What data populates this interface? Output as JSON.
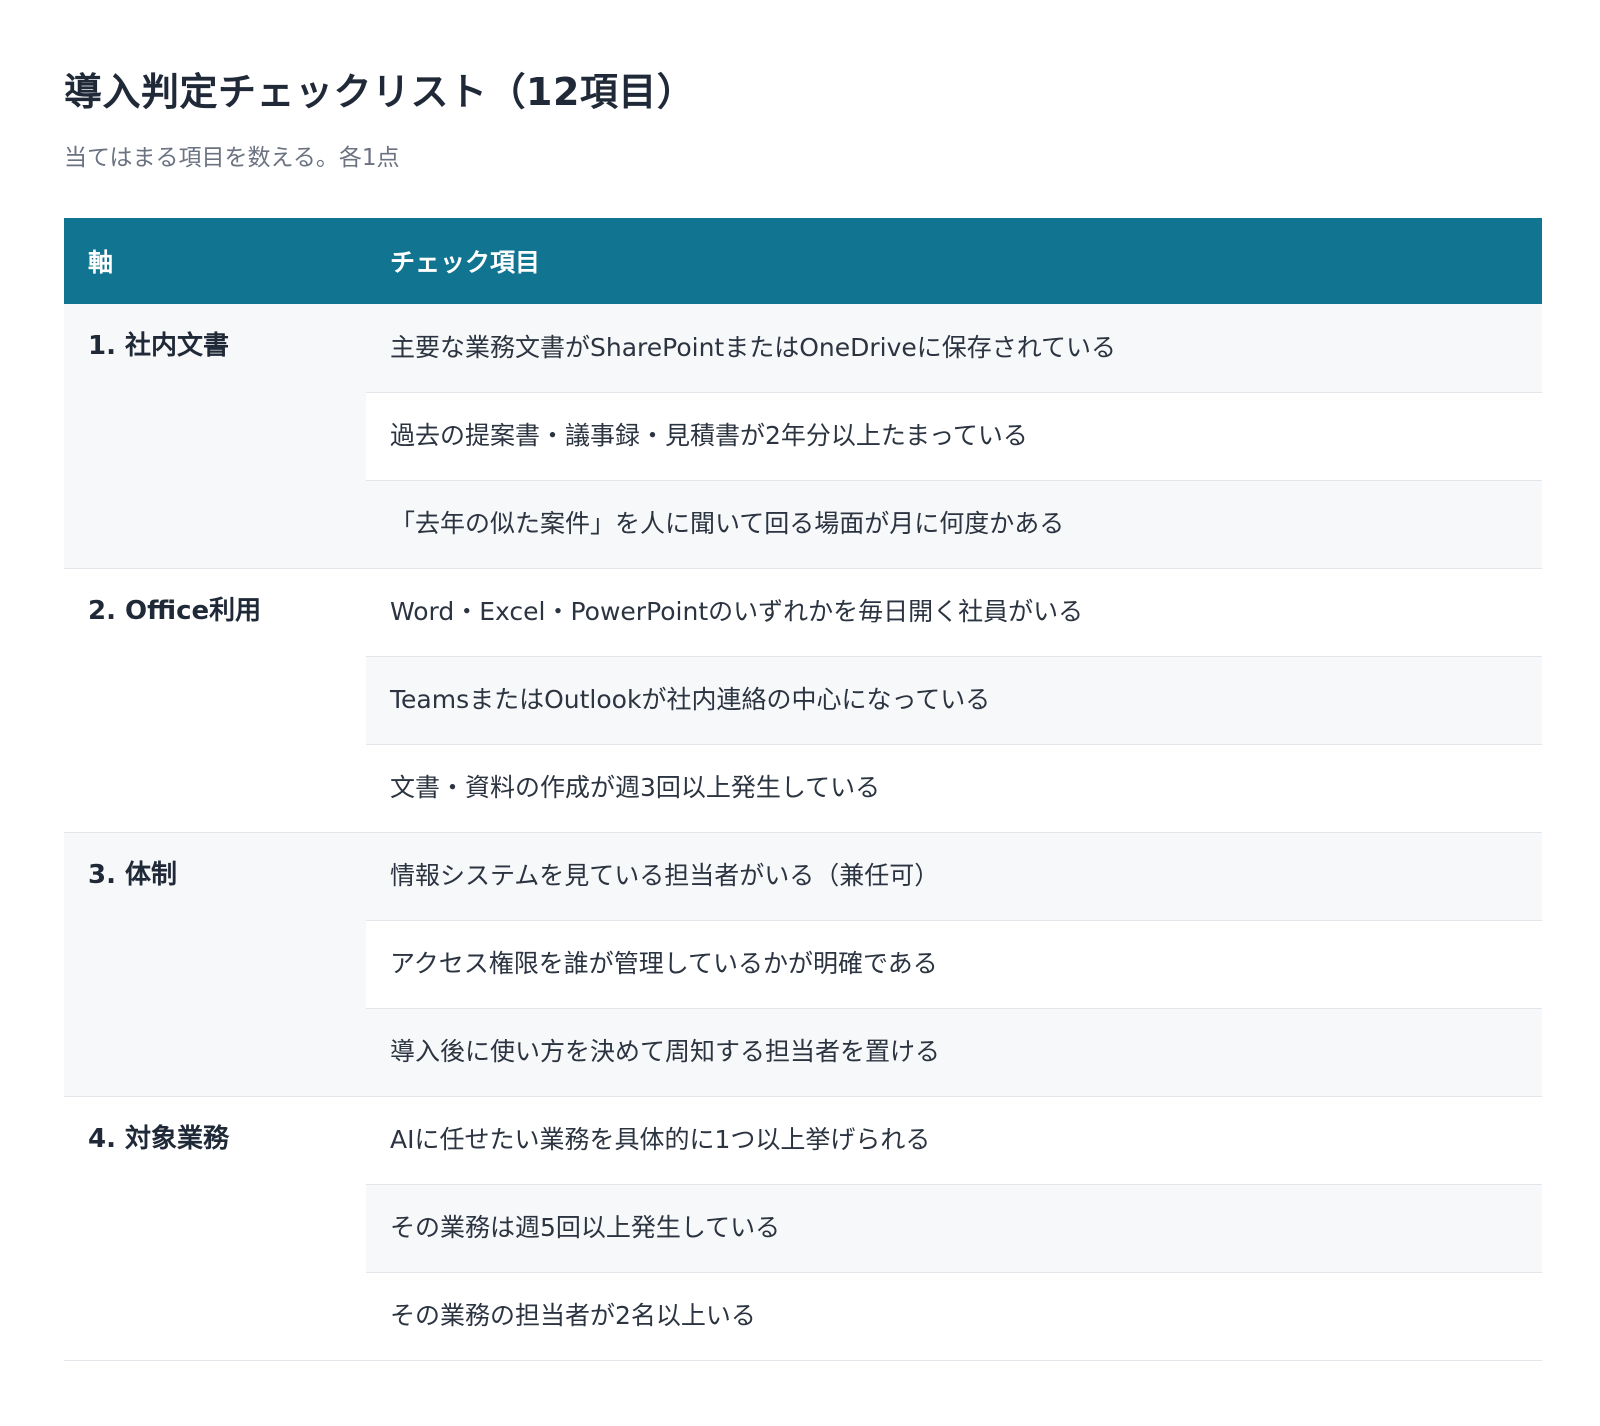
{
  "title": "導入判定チェックリスト（12項目）",
  "subtitle": "当てはまる項目を数える。各1点",
  "table": {
    "headers": {
      "axis": "軸",
      "item": "チェック項目"
    },
    "groups": [
      {
        "axis": "1. 社内文書",
        "items": [
          "主要な業務文書がSharePointまたはOneDriveに保存されている",
          "過去の提案書・議事録・見積書が2年分以上たまっている",
          "「去年の似た案件」を人に聞いて回る場面が月に何度かある"
        ]
      },
      {
        "axis": "2. Office利用",
        "items": [
          "Word・Excel・PowerPointのいずれかを毎日開く社員がいる",
          "TeamsまたはOutlookが社内連絡の中心になっている",
          "文書・資料の作成が週3回以上発生している"
        ]
      },
      {
        "axis": "3. 体制",
        "items": [
          "情報システムを見ている担当者がいる（兼任可）",
          "アクセス権限を誰が管理しているかが明確である",
          "導入後に使い方を決めて周知する担当者を置ける"
        ]
      },
      {
        "axis": "4. 対象業務",
        "items": [
          "AIに任せたい業務を具体的に1つ以上挙げられる",
          "その業務は週5回以上発生している",
          "その業務の担当者が2名以上いる"
        ]
      }
    ]
  },
  "colors": {
    "header_bg": "#117491",
    "row_shade": "#f7f8fa",
    "border": "#e2e6ea"
  }
}
